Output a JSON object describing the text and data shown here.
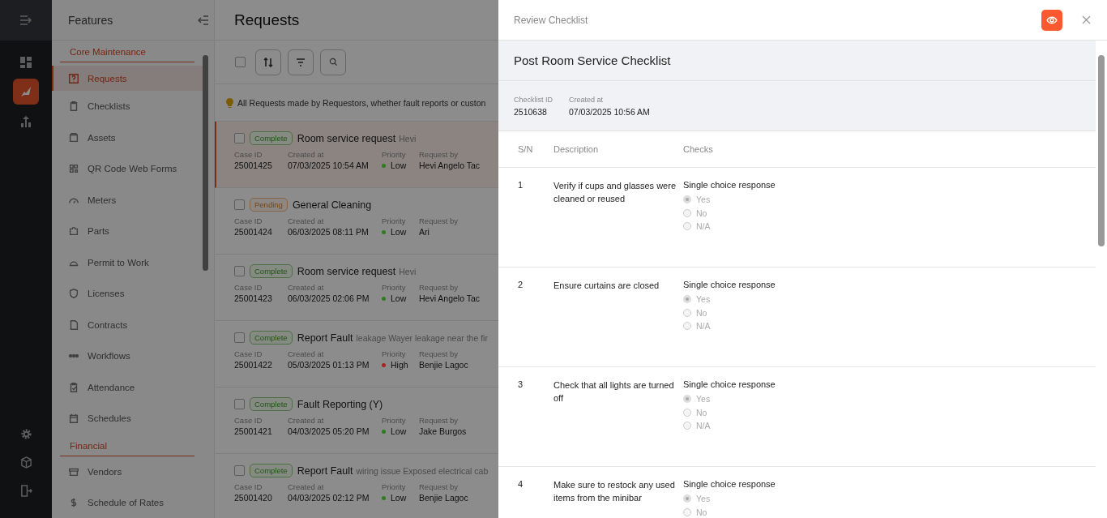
{
  "features_panel": {
    "title": "Features",
    "sections": [
      {
        "heading": "Core Maintenance",
        "items": [
          {
            "label": "Requests",
            "selected": true
          },
          {
            "label": "Checklists",
            "selected": false
          },
          {
            "label": "Assets",
            "selected": false
          },
          {
            "label": "QR Code Web Forms",
            "selected": false
          },
          {
            "label": "Meters",
            "selected": false
          },
          {
            "label": "Parts",
            "selected": false
          },
          {
            "label": "Permit to Work",
            "selected": false
          },
          {
            "label": "Licenses",
            "selected": false
          },
          {
            "label": "Contracts",
            "selected": false
          },
          {
            "label": "Workflows",
            "selected": false
          },
          {
            "label": "Attendance",
            "selected": false
          },
          {
            "label": "Schedules",
            "selected": false
          }
        ]
      },
      {
        "heading": "Financial",
        "items": [
          {
            "label": "Vendors",
            "selected": false
          },
          {
            "label": "Schedule of Rates",
            "selected": false
          }
        ]
      }
    ]
  },
  "requests": {
    "title": "Requests",
    "select_all_checked": false,
    "info": "All Requests made by Requestors, whether fault reports or custon",
    "rows": [
      {
        "checked": false,
        "status": "Complete",
        "kind": "complete",
        "title": "Room service request",
        "subtitle": "Hevi",
        "fields": [
          {
            "label": "Case ID",
            "value": "25001425"
          },
          {
            "label": "Created at",
            "value": "07/03/2025 10:54 AM"
          },
          {
            "label": "Priority",
            "value": "Low",
            "color": "#2f7a22"
          },
          {
            "label": "Request by",
            "value": "Hevi Angelo Tac"
          }
        ],
        "selected": true
      },
      {
        "checked": false,
        "status": "Pending",
        "kind": "pending",
        "title": "General Cleaning",
        "fields": [
          {
            "label": "Case ID",
            "value": "25001424"
          },
          {
            "label": "Created at",
            "value": "06/03/2025 08:11 PM"
          },
          {
            "label": "Priority",
            "value": "Low",
            "color": "#2f7a22"
          },
          {
            "label": "Request by",
            "value": "Ari"
          }
        ],
        "selected": false
      },
      {
        "checked": false,
        "status": "Complete",
        "kind": "complete",
        "title": "Room service request",
        "subtitle": "Hevi",
        "fields": [
          {
            "label": "Case ID",
            "value": "25001423"
          },
          {
            "label": "Created at",
            "value": "06/03/2025 02:06 PM"
          },
          {
            "label": "Priority",
            "value": "Low",
            "color": "#2f7a22"
          },
          {
            "label": "Request by",
            "value": "Hevi Angelo Tac"
          }
        ],
        "selected": false
      },
      {
        "checked": false,
        "status": "Complete",
        "kind": "complete",
        "title": "Report Fault",
        "subtitle": "leakage Wayer leakage near the fir",
        "fields": [
          {
            "label": "Case ID",
            "value": "25001422"
          },
          {
            "label": "Created at",
            "value": "05/03/2025 01:13 PM"
          },
          {
            "label": "Priority",
            "value": "High",
            "color": "#a82323"
          },
          {
            "label": "Request by",
            "value": "Benjie Lagoc"
          }
        ],
        "selected": false
      },
      {
        "checked": false,
        "status": "Complete",
        "kind": "complete",
        "title": "Fault Reporting (Y)",
        "fields": [
          {
            "label": "Case ID",
            "value": "25001421"
          },
          {
            "label": "Created at",
            "value": "04/03/2025 05:20 PM"
          },
          {
            "label": "Priority",
            "value": "Low",
            "color": "#2f7a22"
          },
          {
            "label": "Request by",
            "value": "Jake Burgos"
          }
        ],
        "selected": false
      },
      {
        "checked": false,
        "status": "Complete",
        "kind": "complete",
        "title": "Report Fault",
        "subtitle": "wiring issue Exposed electrical cab",
        "fields": [
          {
            "label": "Case ID",
            "value": "25001420"
          },
          {
            "label": "Created at",
            "value": "04/03/2025 02:12 PM"
          },
          {
            "label": "Priority",
            "value": "Low",
            "color": "#2f7a22"
          },
          {
            "label": "Request by",
            "value": "Benjie Lagoc"
          }
        ],
        "selected": false
      }
    ]
  },
  "drawer": {
    "title": "Review Checklist",
    "checklist_title": "Post Room Service Checklist",
    "meta": [
      {
        "label": "Checklist ID",
        "value": "2510638"
      },
      {
        "label": "Created at",
        "value": "07/03/2025 10:56 AM"
      }
    ],
    "columns": [
      "S/N",
      "Description",
      "Checks"
    ],
    "items": [
      {
        "sn": "1",
        "description": "Verify if cups and glasses were cleaned or reused",
        "check_type": "Single choice response",
        "options": [
          {
            "label": "Yes",
            "selected": true
          },
          {
            "label": "No",
            "selected": false
          },
          {
            "label": "N/A",
            "selected": false
          }
        ]
      },
      {
        "sn": "2",
        "description": "Ensure curtains are closed",
        "check_type": "Single choice response",
        "options": [
          {
            "label": "Yes",
            "selected": true
          },
          {
            "label": "No",
            "selected": false
          },
          {
            "label": "N/A",
            "selected": false
          }
        ]
      },
      {
        "sn": "3",
        "description": "Check that all lights are turned off",
        "check_type": "Single choice response",
        "options": [
          {
            "label": "Yes",
            "selected": true
          },
          {
            "label": "No",
            "selected": false
          },
          {
            "label": "N/A",
            "selected": false
          }
        ]
      },
      {
        "sn": "4",
        "description": "Make sure to restock any used items from the minibar",
        "check_type": "Single choice response",
        "options": [
          {
            "label": "Yes",
            "selected": true
          },
          {
            "label": "No",
            "selected": false
          }
        ]
      }
    ]
  }
}
